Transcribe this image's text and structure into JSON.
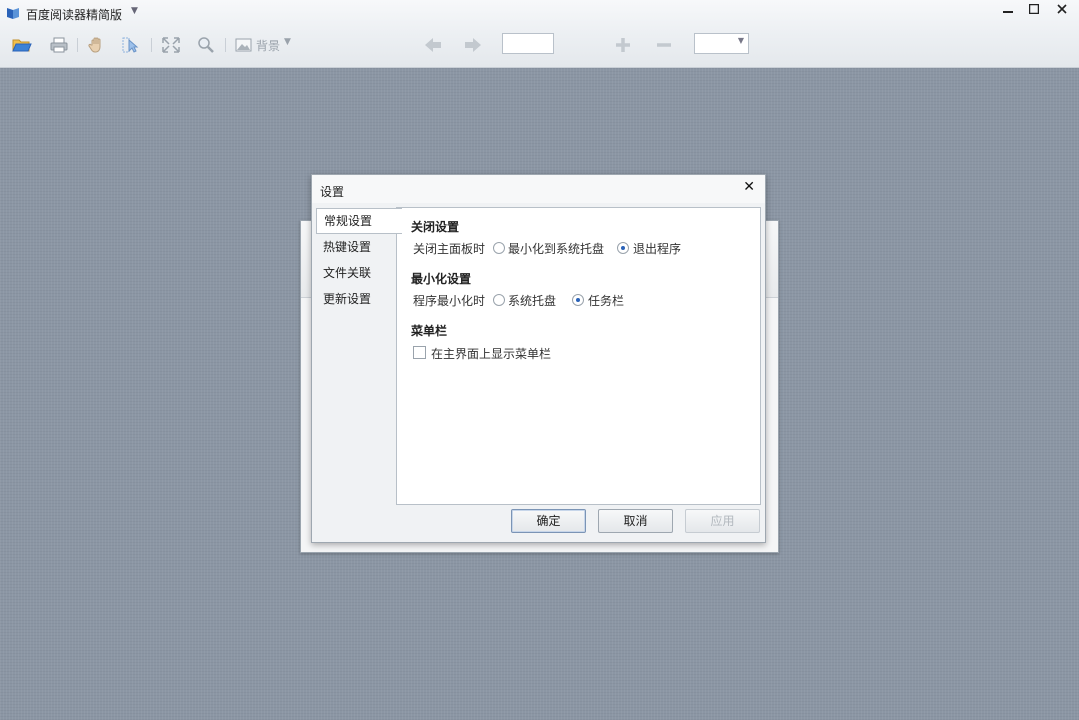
{
  "app": {
    "title": "百度阅读器精简版",
    "logo_icon": "book-logo-icon",
    "accent": "#2a62b8"
  },
  "window_controls": {
    "minimize": "▬",
    "maximize": "□",
    "close": "✕"
  },
  "toolbar": {
    "background_label": "背景",
    "page_value": "",
    "zoom_value": ""
  },
  "settings_dialog": {
    "title": "设置",
    "close_glyph": "✕",
    "nav": [
      "常规设置",
      "热键设置",
      "文件关联",
      "更新设置"
    ],
    "close_section": {
      "title": "关闭设置",
      "label": "关闭主面板时",
      "options": [
        "最小化到系统托盘",
        "退出程序"
      ],
      "selected": "退出程序"
    },
    "minimize_section": {
      "title": "最小化设置",
      "label": "程序最小化时",
      "options": [
        "系统托盘",
        "任务栏"
      ],
      "selected": "任务栏"
    },
    "menubar_section": {
      "title": "菜单栏",
      "checkbox_label": "在主界面上显示菜单栏",
      "checked": false
    },
    "buttons": {
      "ok": "确定",
      "cancel": "取消",
      "apply": "应用"
    }
  }
}
